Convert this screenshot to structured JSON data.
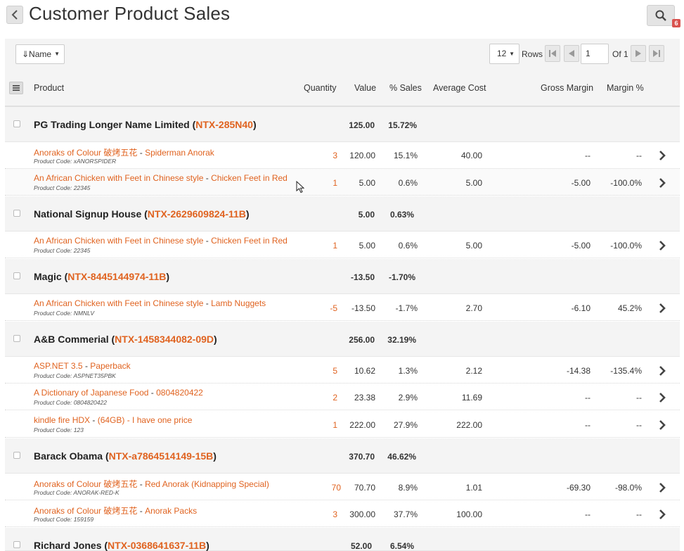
{
  "header": {
    "title": "Customer Product Sales",
    "notification_count": "6"
  },
  "toolbar": {
    "sort_label": "⇓Name",
    "rows_value": "12",
    "rows_label": "Rows",
    "page_value": "1",
    "of_label": "Of 1"
  },
  "columns": {
    "product": "Product",
    "quantity": "Quantity",
    "value": "Value",
    "sales": "% Sales",
    "avg_cost": "Average Cost",
    "gross_margin": "Gross Margin",
    "margin_pct": "Margin %"
  },
  "groups": [
    {
      "name": "PG Trading Longer Name Limited",
      "code": "NTX-285N40",
      "value": "125.00",
      "sales": "15.72%",
      "items": [
        {
          "category": "Anoraks of Colour 破烤五花",
          "product": "Spiderman Anorak",
          "code_label": "Product Code: xANORSPIDER",
          "qty": "3",
          "value": "120.00",
          "sales": "15.1%",
          "avg": "40.00",
          "gm": "--",
          "mp": "--"
        },
        {
          "category": "An African Chicken with Feet in Chinese style",
          "product": "Chicken Feet in Red",
          "code_label": "Product Code: 22345",
          "qty": "1",
          "value": "5.00",
          "sales": "0.6%",
          "avg": "5.00",
          "gm": "-5.00",
          "mp": "-100.0%"
        }
      ]
    },
    {
      "name": "National Signup House",
      "code": "NTX-2629609824-11B",
      "value": "5.00",
      "sales": "0.63%",
      "items": [
        {
          "category": "An African Chicken with Feet in Chinese style",
          "product": "Chicken Feet in Red",
          "code_label": "Product Code: 22345",
          "qty": "1",
          "value": "5.00",
          "sales": "0.6%",
          "avg": "5.00",
          "gm": "-5.00",
          "mp": "-100.0%"
        }
      ]
    },
    {
      "name": "Magic",
      "code": "NTX-8445144974-11B",
      "value": "-13.50",
      "sales": "-1.70%",
      "items": [
        {
          "category": "An African Chicken with Feet in Chinese style",
          "product": "Lamb Nuggets",
          "code_label": "Product Code: NMNLV",
          "qty": "-5",
          "value": "-13.50",
          "sales": "-1.7%",
          "avg": "2.70",
          "gm": "-6.10",
          "mp": "45.2%"
        }
      ]
    },
    {
      "name": "A&B Commerial",
      "code": "NTX-1458344082-09D",
      "value": "256.00",
      "sales": "32.19%",
      "items": [
        {
          "category": "ASP.NET 3.5",
          "product": "Paperback",
          "code_label": "Product Code: ASPNET35PBK",
          "qty": "5",
          "value": "10.62",
          "sales": "1.3%",
          "avg": "2.12",
          "gm": "-14.38",
          "mp": "-135.4%"
        },
        {
          "category": "A Dictionary of Japanese Food",
          "product": "0804820422",
          "code_label": "Product Code: 0804820422",
          "qty": "2",
          "value": "23.38",
          "sales": "2.9%",
          "avg": "11.69",
          "gm": "--",
          "mp": "--"
        },
        {
          "category": "kindle fire HDX",
          "product": "(64GB) - I have one price",
          "code_label": "Product Code: 123",
          "qty": "1",
          "value": "222.00",
          "sales": "27.9%",
          "avg": "222.00",
          "gm": "--",
          "mp": "--"
        }
      ]
    },
    {
      "name": "Barack Obama",
      "code": "NTX-a7864514149-15B",
      "value": "370.70",
      "sales": "46.62%",
      "items": [
        {
          "category": "Anoraks of Colour 破烤五花",
          "product": "Red Anorak (Kidnapping Special)",
          "code_label": "Product Code: ANORAK-RED-K",
          "qty": "70",
          "value": "70.70",
          "sales": "8.9%",
          "avg": "1.01",
          "gm": "-69.30",
          "mp": "-98.0%"
        },
        {
          "category": "Anoraks of Colour 破烤五花",
          "product": "Anorak Packs",
          "code_label": "Product Code: 159159",
          "qty": "3",
          "value": "300.00",
          "sales": "37.7%",
          "avg": "100.00",
          "gm": "--",
          "mp": "--"
        }
      ]
    },
    {
      "name": "Richard Jones",
      "code": "NTX-0368641637-11B",
      "value": "52.00",
      "sales": "6.54%",
      "items": []
    }
  ],
  "colors": {
    "accent": "#e06320",
    "header_bg": "#f4f4f4",
    "badge": "#d9534f"
  }
}
